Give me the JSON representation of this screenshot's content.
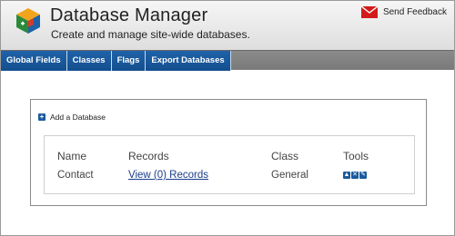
{
  "header": {
    "title": "Database Manager",
    "subtitle": "Create and manage site-wide databases.",
    "feedback_label": "Send Feedback"
  },
  "nav": {
    "tabs": [
      {
        "label": "Global Fields"
      },
      {
        "label": "Classes"
      },
      {
        "label": "Flags"
      },
      {
        "label": "Export Databases"
      }
    ]
  },
  "panel": {
    "add_label": "Add a Database",
    "table": {
      "columns": [
        "Name",
        "Records",
        "Class",
        "Tools"
      ],
      "rows": [
        {
          "name": "Contact",
          "records": "View (0) Records",
          "class": "General",
          "tools": [
            "up-icon",
            "delete-icon",
            "edit-icon"
          ]
        }
      ]
    }
  },
  "colors": {
    "tab_blue": "#1f62a8",
    "header_bg": "#e6e6e6",
    "link": "#1a3d8a",
    "mail_red": "#d31a1a"
  }
}
